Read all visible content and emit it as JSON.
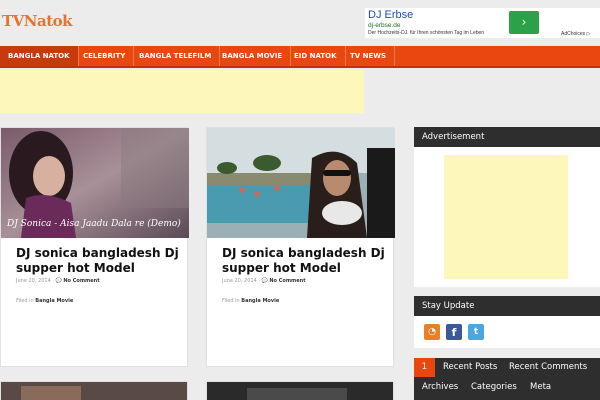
{
  "site": {
    "logo": "TVNatok"
  },
  "top_ad": {
    "title": "DJ Erbse",
    "url": "dj-erbse.de",
    "description": "Der Hochzeits-DJ. für Ihren schönsten Tag im Leben",
    "go_glyph": "›",
    "adchoices": "AdChoices ▷"
  },
  "nav": {
    "items": [
      "BANGLA NATOK",
      "CELEBRITY",
      "BANGLA TELEFILM",
      "BANGLA MOVIE",
      "EID NATOK",
      "TV NEWS"
    ]
  },
  "posts": [
    {
      "caption": "DJ Sonica - Aisa Jaadu Dala re (Demo)",
      "title": "DJ sonica bangladesh Dj supper hot Model",
      "date": "June 20, 2014",
      "comments": "No Comment",
      "filed_label": "Filed in",
      "category": "Bangla Movie"
    },
    {
      "caption": "",
      "title": "DJ sonica bangladesh Dj supper hot Model",
      "date": "June 20, 2014",
      "comments": "No Comment",
      "filed_label": "Filed in",
      "category": "Bangla Movie"
    }
  ],
  "sidebar": {
    "advertisement_title": "Advertisement",
    "stay_update_title": "Stay Update",
    "social_icons": [
      "rss-icon",
      "facebook-icon",
      "twitter-icon"
    ],
    "tabs_row1": [
      "1",
      "Recent Posts",
      "Recent Comments"
    ],
    "tabs_row2": [
      "Archives",
      "Categories",
      "Meta"
    ]
  },
  "colors": {
    "accent": "#e8470f",
    "logo": "#e8732a",
    "widget_header": "#2e2e2e",
    "ad_placeholder": "#fdf7b9"
  }
}
